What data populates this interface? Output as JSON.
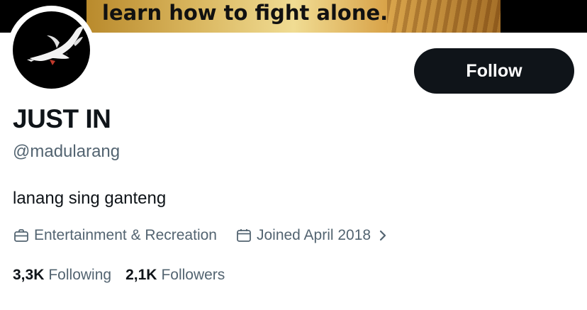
{
  "banner": {
    "caption": "learn how to fight alone."
  },
  "avatar": {
    "icon": "dove-icon"
  },
  "profile": {
    "follow_label": "Follow",
    "display_name": "JUST IN",
    "handle": "@madularang",
    "bio": "lanang sing ganteng",
    "category": "Entertainment & Recreation",
    "category_icon": "briefcase-icon",
    "joined": "Joined April 2018",
    "joined_icon": "calendar-icon"
  },
  "stats": {
    "following_count": "3,3K",
    "following_label": "Following",
    "followers_count": "2,1K",
    "followers_label": "Followers"
  },
  "colors": {
    "text_primary": "#0f1419",
    "text_secondary": "#536471",
    "button_bg": "#0f1419"
  }
}
